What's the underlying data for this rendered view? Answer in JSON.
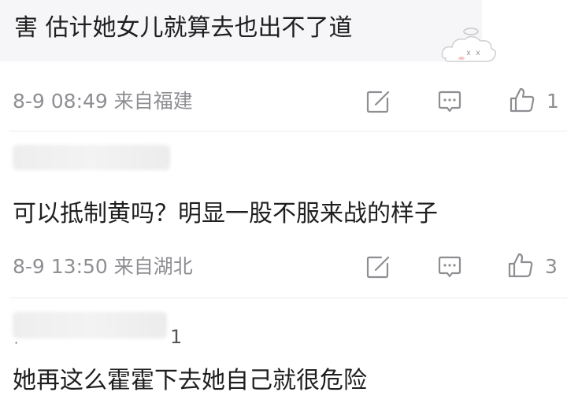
{
  "comments": [
    {
      "text": "害 估计她女儿就算去也出不了道",
      "meta": "8-9 08:49 来自福建",
      "likes": "1"
    },
    {
      "text": "可以抵制黄吗？明显一股不服来战的样子",
      "meta": "8-9 13:50 来自湖北",
      "likes": "3"
    },
    {
      "username_suffix": "1",
      "text": "她再这么霍霍下去她自己就很危险"
    }
  ],
  "icons": {
    "share": "share-icon",
    "comment": "comment-icon",
    "like": "thumbs-up-icon"
  },
  "colors": {
    "meta_text": "#8e8e93",
    "body_text": "#1f1f1f",
    "bubble_bg": "#f6f5f8",
    "divider": "#ececec"
  }
}
